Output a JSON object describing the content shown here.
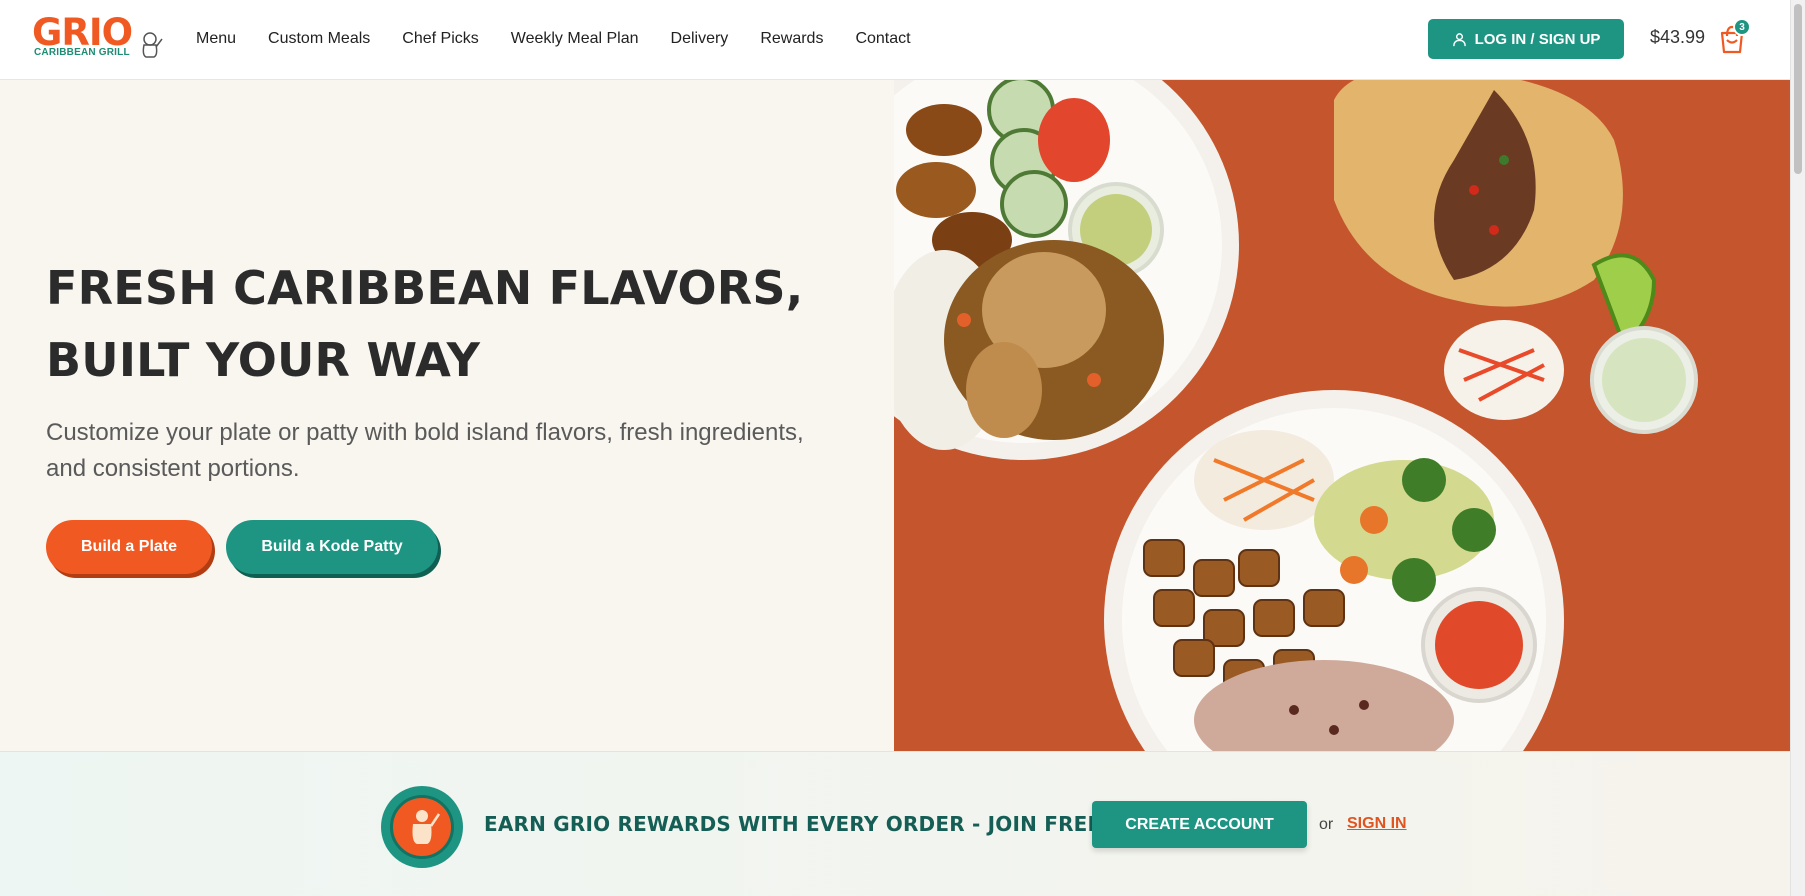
{
  "brand": {
    "name": "GRIO",
    "tagline": "CARIBBEAN GRILL",
    "primary_color": "#f05a22",
    "accent_color": "#1e9582"
  },
  "nav": {
    "items": [
      {
        "label": "Menu"
      },
      {
        "label": "Custom Meals"
      },
      {
        "label": "Chef Picks"
      },
      {
        "label": "Weekly Meal Plan"
      },
      {
        "label": "Delivery"
      },
      {
        "label": "Rewards"
      },
      {
        "label": "Contact"
      }
    ]
  },
  "account": {
    "login_label": "LOG IN / SIGN UP",
    "login_icon": "user-icon"
  },
  "cart": {
    "total": "$43.99",
    "count": "3",
    "icon": "shopping-bag-icon"
  },
  "hero": {
    "title_line1": "FRESH CARIBBEAN FLAVORS,",
    "title_line2": "BUILT YOUR WAY",
    "subtitle": "Customize your plate or patty with bold island flavors, fresh ingredients, and consistent portions.",
    "primary_cta": "Build a Plate",
    "secondary_cta": "Build a Kode Patty",
    "image_background": "#c5552c"
  },
  "rewards": {
    "badge_icon": "mascot-badge-icon",
    "text": "EARN GRIO REWARDS WITH EVERY ORDER - JOIN FREE",
    "create_account": "CREATE ACCOUNT",
    "or": "or",
    "sign_in": "SIGN IN"
  }
}
